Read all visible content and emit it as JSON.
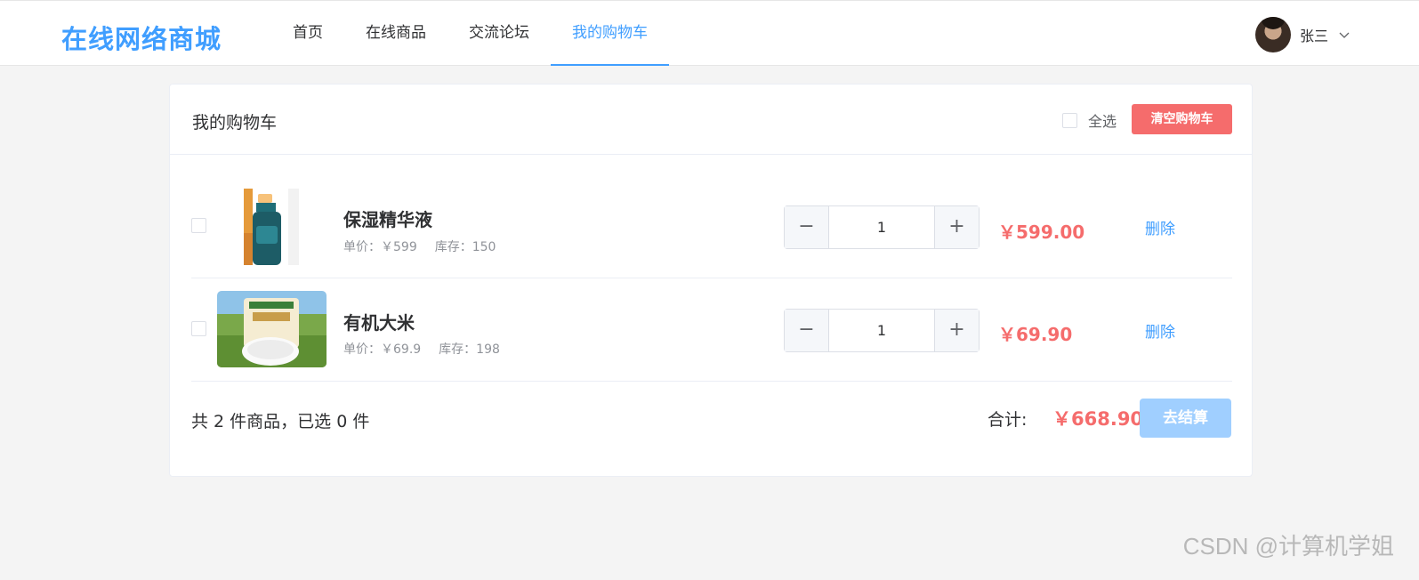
{
  "header": {
    "logo": "在线网络商城",
    "nav": [
      {
        "label": "首页",
        "active": false
      },
      {
        "label": "在线商品",
        "active": false
      },
      {
        "label": "交流论坛",
        "active": false
      },
      {
        "label": "我的购物车",
        "active": true
      }
    ],
    "user_name": "张三"
  },
  "cart": {
    "title": "我的购物车",
    "select_all_label": "全选",
    "clear_label": "清空购物车",
    "items": [
      {
        "name": "保湿精华液",
        "unit_price": "单价：￥599",
        "stock": "库存：150",
        "quantity": "1",
        "minus": "−",
        "plus": "+",
        "subtotal": "￥599.00",
        "delete_label": "删除"
      },
      {
        "name": "有机大米",
        "unit_price": "单价：￥69.9",
        "stock": "库存：198",
        "quantity": "1",
        "minus": "−",
        "plus": "+",
        "subtotal": "￥69.90",
        "delete_label": "删除"
      }
    ],
    "summary": "共 2 件商品，已选 0 件",
    "total_label": "合计:",
    "total_value": "￥668.90",
    "checkout_label": "去结算"
  },
  "colors": {
    "accent": "#409eff",
    "danger": "#f56c6c",
    "disabled_primary": "#a0cfff"
  },
  "watermark": "CSDN @计算机学姐"
}
